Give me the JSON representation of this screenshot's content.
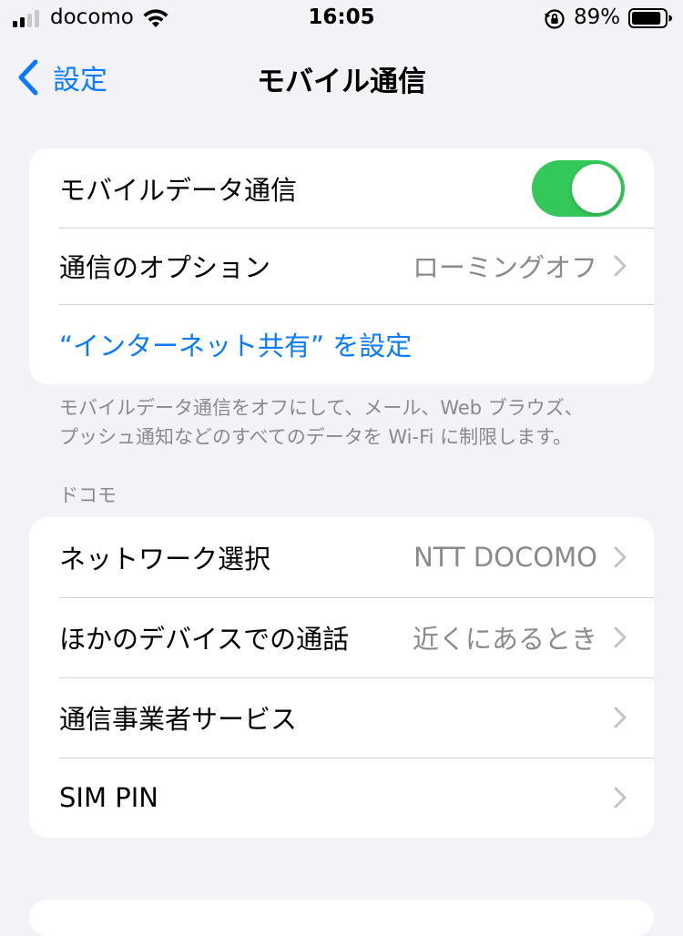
{
  "status_bar": {
    "carrier": "docomo",
    "time": "16:05",
    "battery_percent": "89%",
    "battery_level": 0.89,
    "signal_bars": 2
  },
  "nav": {
    "back_label": "設定",
    "title": "モバイル通信"
  },
  "group1": {
    "mobile_data_label": "モバイルデータ通信",
    "mobile_data_on": true,
    "options_label": "通信のオプション",
    "options_value": "ローミングオフ",
    "hotspot_link": "“インターネット共有” を設定"
  },
  "group1_footer": {
    "line1": "モバイルデータ通信をオフにして、メール、Web ブラウズ、",
    "line2": "プッシュ通知などのすべてのデータを Wi-Fi に制限します。"
  },
  "section2": {
    "header": "ドコモ",
    "rows": [
      {
        "label": "ネットワーク選択",
        "value": "NTT DOCOMO"
      },
      {
        "label": "ほかのデバイスでの通話",
        "value": "近くにあるとき"
      },
      {
        "label": "通信事業者サービス",
        "value": ""
      },
      {
        "label": "SIM PIN",
        "value": ""
      }
    ]
  },
  "colors": {
    "accent": "#0a7aff",
    "toggle_on": "#34c759",
    "background": "#f2f2f7",
    "secondary_text": "#8a8a8e"
  }
}
